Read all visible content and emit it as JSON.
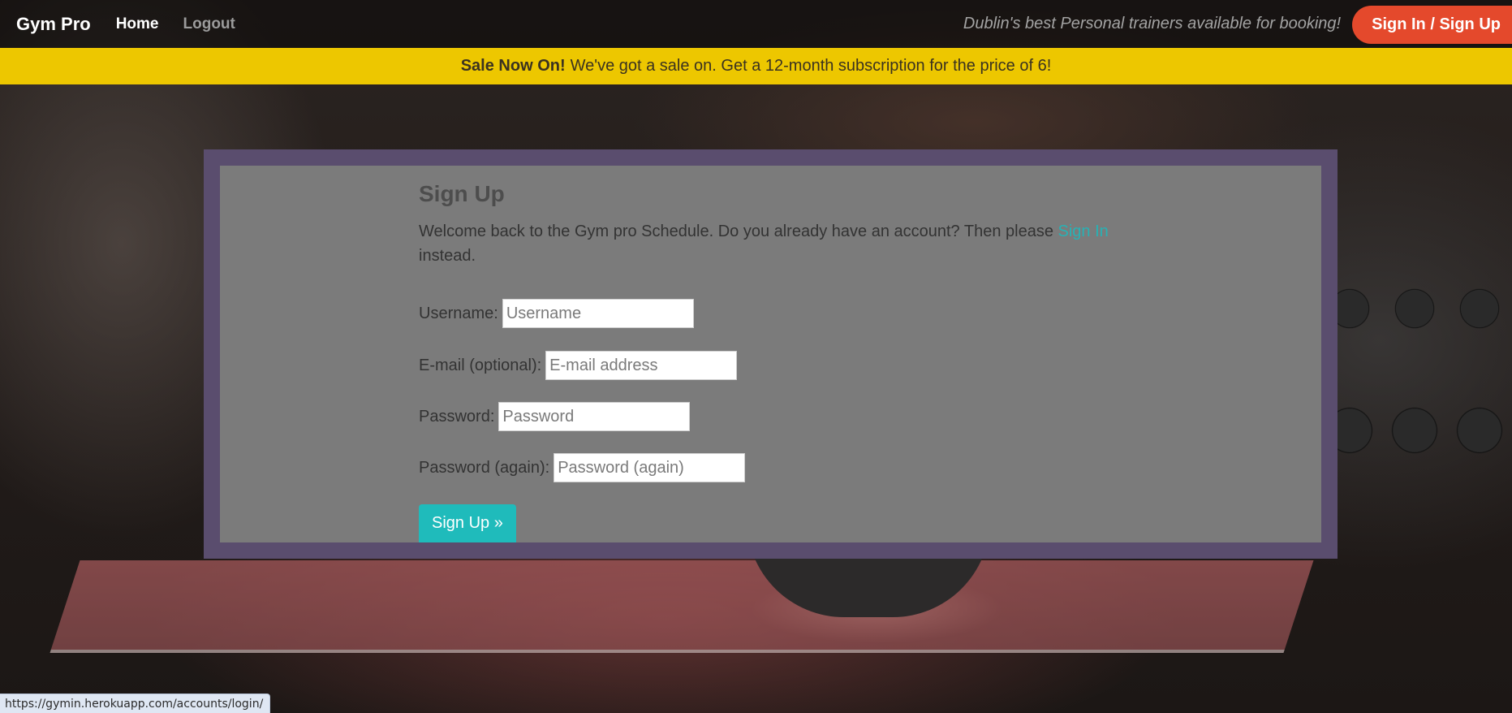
{
  "navbar": {
    "brand": "Gym Pro",
    "home_label": "Home",
    "logout_label": "Logout",
    "tagline": "Dublin's best Personal trainers available for booking!",
    "signin_label": "Sign In / Sign Up"
  },
  "sale": {
    "strong": "Sale Now On!",
    "text": "We've got a sale on. Get a 12-month subscription for the price of 6!"
  },
  "signup": {
    "title": "Sign Up",
    "intro_before": "Welcome back to the Gym pro Schedule. Do you already have an account? Then please ",
    "intro_link": "Sign In",
    "intro_after": " instead.",
    "fields": [
      {
        "label": "Username:",
        "placeholder": "Username"
      },
      {
        "label": "E-mail (optional):",
        "placeholder": "E-mail address"
      },
      {
        "label": "Password:",
        "placeholder": "Password"
      },
      {
        "label": "Password (again):",
        "placeholder": "Password (again)"
      }
    ],
    "submit_label": "Sign Up »"
  },
  "statusbar": {
    "url": "https://gymin.herokuapp.com/accounts/login/"
  },
  "colors": {
    "accent_teal": "#1fbbbb",
    "signin_red": "#e4492c",
    "sale_yellow": "#edc700",
    "panel_border": "#5a4d6e",
    "panel_fill": "#7b7b7b"
  }
}
